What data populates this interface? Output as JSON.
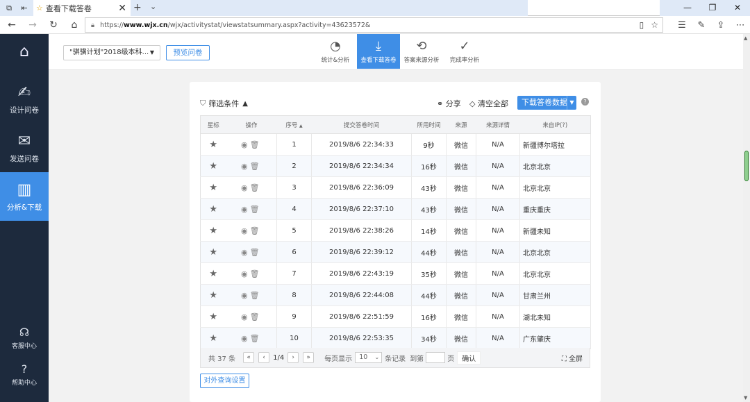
{
  "browser": {
    "tab_title": "查看下载答卷",
    "url_prefix": "https://",
    "url_domain": "www.wjx.cn",
    "url_path": "/wjx/activitystat/viewstatsummary.aspx?activity=43623572&"
  },
  "sidebar": {
    "items": [
      {
        "label": "设计问卷",
        "icon": "edit-icon"
      },
      {
        "label": "发送问卷",
        "icon": "send-icon"
      },
      {
        "label": "分析&下载",
        "icon": "analysis-icon"
      }
    ],
    "service": "客服中心",
    "help": "帮助中心"
  },
  "topbar": {
    "survey_name": "\"骐骥计划\"2018级本科...",
    "preview": "预览问卷",
    "tabs": [
      "统计&分析",
      "查看下载答卷",
      "答案来源分析",
      "完成率分析"
    ]
  },
  "toolbar": {
    "filter": "筛选条件",
    "share": "分享",
    "clear": "清空全部",
    "download": "下载答卷数据"
  },
  "table": {
    "headers": [
      "星标",
      "操作",
      "序号",
      "提交答卷时间",
      "所用时间",
      "来源",
      "来源详情",
      "来自IP(?)"
    ],
    "rows": [
      {
        "no": "1",
        "time": "2019/8/6 22:34:33",
        "dur": "9秒",
        "src": "微信",
        "detail": "N/A",
        "ip": "新疆博尔塔拉"
      },
      {
        "no": "2",
        "time": "2019/8/6 22:34:34",
        "dur": "16秒",
        "src": "微信",
        "detail": "N/A",
        "ip": "北京北京"
      },
      {
        "no": "3",
        "time": "2019/8/6 22:36:09",
        "dur": "43秒",
        "src": "微信",
        "detail": "N/A",
        "ip": "北京北京"
      },
      {
        "no": "4",
        "time": "2019/8/6 22:37:10",
        "dur": "43秒",
        "src": "微信",
        "detail": "N/A",
        "ip": "重庆重庆"
      },
      {
        "no": "5",
        "time": "2019/8/6 22:38:26",
        "dur": "14秒",
        "src": "微信",
        "detail": "N/A",
        "ip": "新疆未知"
      },
      {
        "no": "6",
        "time": "2019/8/6 22:39:12",
        "dur": "44秒",
        "src": "微信",
        "detail": "N/A",
        "ip": "北京北京"
      },
      {
        "no": "7",
        "time": "2019/8/6 22:43:19",
        "dur": "35秒",
        "src": "微信",
        "detail": "N/A",
        "ip": "北京北京"
      },
      {
        "no": "8",
        "time": "2019/8/6 22:44:08",
        "dur": "44秒",
        "src": "微信",
        "detail": "N/A",
        "ip": "甘肃兰州"
      },
      {
        "no": "9",
        "time": "2019/8/6 22:51:59",
        "dur": "16秒",
        "src": "微信",
        "detail": "N/A",
        "ip": "湖北未知"
      },
      {
        "no": "10",
        "time": "2019/8/6 22:53:35",
        "dur": "34秒",
        "src": "微信",
        "detail": "N/A",
        "ip": "广东肇庆"
      }
    ]
  },
  "pager": {
    "total": "共 37 条",
    "page": "1/4",
    "per_page_label": "每页显示",
    "per_page": "10",
    "records": "条记录",
    "goto": "到第",
    "page_unit": "页",
    "confirm": "确认",
    "fullscreen": "全屏"
  },
  "extra": {
    "query_settings": "对外查询设置"
  },
  "colors": {
    "accent": "#3f8ee6",
    "sidebar": "#1d2a3d"
  }
}
